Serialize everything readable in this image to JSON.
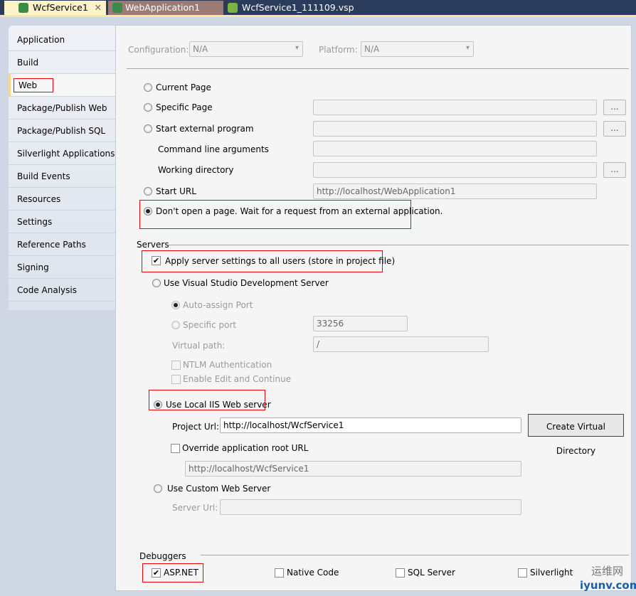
{
  "tabs": [
    {
      "label": "WcfService1",
      "close": "✕"
    },
    {
      "label": "WebApplication1"
    },
    {
      "label": "WcfService1_111109.vsp"
    }
  ],
  "sidebar": {
    "items": [
      {
        "label": "Application"
      },
      {
        "label": "Build"
      },
      {
        "label": "Web"
      },
      {
        "label": "Package/Publish Web"
      },
      {
        "label": "Package/Publish SQL"
      },
      {
        "label": "Silverlight Applications"
      },
      {
        "label": "Build Events"
      },
      {
        "label": "Resources"
      },
      {
        "label": "Settings"
      },
      {
        "label": "Reference Paths"
      },
      {
        "label": "Signing"
      },
      {
        "label": "Code Analysis"
      }
    ],
    "selected": "Web"
  },
  "config": {
    "configuration_label": "Configuration:",
    "configuration_value": "N/A",
    "platform_label": "Platform:",
    "platform_value": "N/A"
  },
  "start": {
    "current_page": "Current Page",
    "specific_page": "Specific Page",
    "external_program": "Start external program",
    "cmd_args": "Command line arguments",
    "working_dir": "Working directory",
    "start_url": "Start URL",
    "start_url_value": "http://localhost/WebApplication1",
    "dont_open": "Don't open a page.  Wait for a request from an external application.",
    "browse": "...",
    "selected": "dont_open"
  },
  "servers": {
    "heading": "Servers",
    "apply_all": "Apply server settings to all users (store in project file)",
    "apply_all_checked": true,
    "vs_dev": "Use Visual Studio Development Server",
    "auto_port": "Auto-assign Port",
    "specific_port": "Specific port",
    "port_value": "33256",
    "virtual_path": "Virtual path:",
    "virtual_path_value": "/",
    "ntlm": "NTLM Authentication",
    "edit_continue": "Enable Edit and Continue",
    "local_iis": "Use Local IIS Web server",
    "project_url": "Project Url:",
    "project_url_value": "http://localhost/WcfService1",
    "create_vdir": "Create Virtual Directory",
    "override_root": "Override application root URL",
    "override_value": "http://localhost/WcfService1",
    "custom": "Use Custom Web Server",
    "server_url": "Server Url:",
    "selected": "local_iis"
  },
  "debuggers": {
    "heading": "Debuggers",
    "items": [
      {
        "label": "ASP.NET",
        "checked": true
      },
      {
        "label": "Native Code",
        "checked": false
      },
      {
        "label": "SQL Server",
        "checked": false
      },
      {
        "label": "Silverlight",
        "checked": false
      }
    ]
  },
  "watermark": {
    "cn": "运维网",
    "en": "iyunv.com"
  },
  "check_glyph": "✔"
}
